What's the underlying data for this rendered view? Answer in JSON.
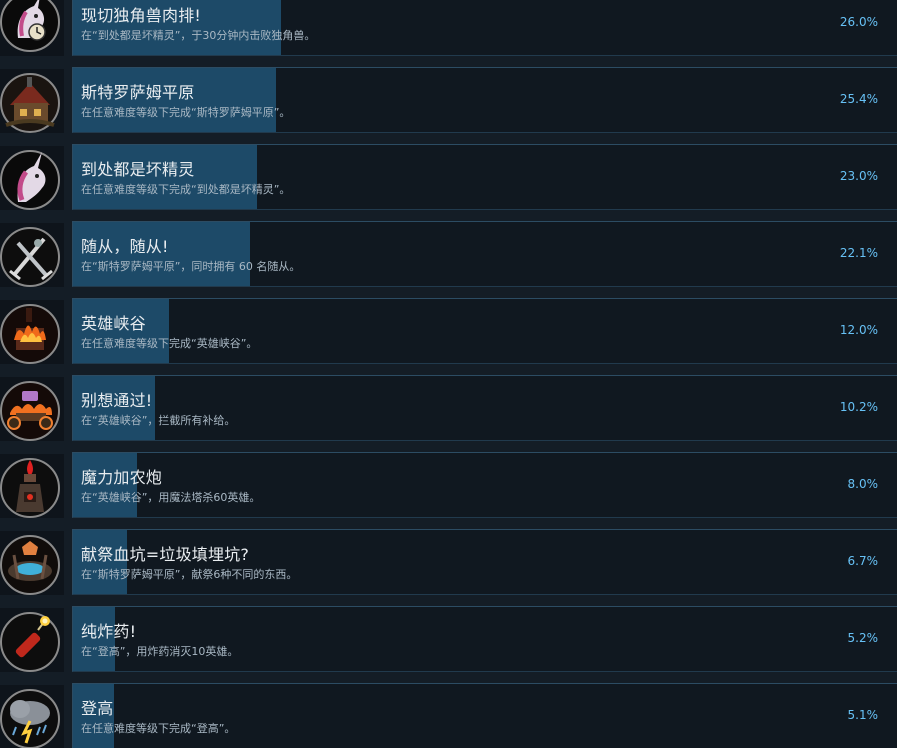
{
  "achievements": [
    {
      "title": "现切独角兽肉排!",
      "description": "在“到处都是坏精灵”，于30分钟内击败独角兽。",
      "percent_label": "26.0%",
      "percent": 26.0,
      "icon": "unicorn-clock-icon"
    },
    {
      "title": "斯特罗萨姆平原",
      "description": "在任意难度等级下完成“斯特罗萨姆平原”。",
      "percent_label": "25.4%",
      "percent": 25.4,
      "icon": "farmhouse-icon"
    },
    {
      "title": "到处都是坏精灵",
      "description": "在任意难度等级下完成“到处都是坏精灵”。",
      "percent_label": "23.0%",
      "percent": 23.0,
      "icon": "unicorn-icon"
    },
    {
      "title": "随从，随从!",
      "description": "在“斯特罗萨姆平原”，同时拥有 60 名随从。",
      "percent_label": "22.1%",
      "percent": 22.1,
      "icon": "crossed-swords-icon"
    },
    {
      "title": "英雄峡谷",
      "description": "在任意难度等级下完成“英雄峡谷”。",
      "percent_label": "12.0%",
      "percent": 12.0,
      "icon": "burning-fortress-icon"
    },
    {
      "title": "别想通过!",
      "description": "在“英雄峡谷”，拦截所有补给。",
      "percent_label": "10.2%",
      "percent": 10.2,
      "icon": "burning-cart-icon"
    },
    {
      "title": "魔力加农炮",
      "description": "在“英雄峡谷”，用魔法塔杀60英雄。",
      "percent_label": "8.0%",
      "percent": 8.0,
      "icon": "mana-tower-icon"
    },
    {
      "title": "献祭血坑=垃圾填埋坑?",
      "description": "在“斯特罗萨姆平原”，献祭6种不同的东西。",
      "percent_label": "6.7%",
      "percent": 6.7,
      "icon": "sacrifice-pit-icon"
    },
    {
      "title": "纯炸药!",
      "description": "在“登高”，用炸药消灭10英雄。",
      "percent_label": "5.2%",
      "percent": 5.2,
      "icon": "dynamite-icon"
    },
    {
      "title": "登高",
      "description": "在任意难度等级下完成“登高”。",
      "percent_label": "5.1%",
      "percent": 5.1,
      "icon": "storm-cloud-icon"
    }
  ],
  "colors": {
    "bar_fill": "#1d4a68",
    "percent_text": "#67c1f5",
    "title_text": "#e9edf0",
    "desc_text": "#a9b8c4"
  }
}
